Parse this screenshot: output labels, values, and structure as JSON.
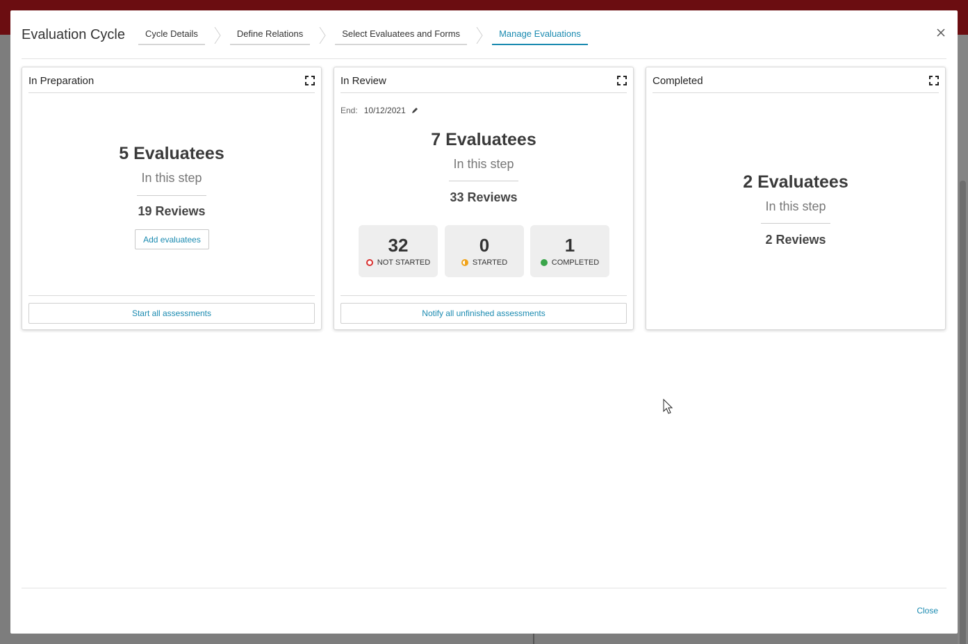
{
  "modal": {
    "title": "Evaluation Cycle",
    "steps": [
      {
        "label": "Cycle Details",
        "active": false
      },
      {
        "label": "Define Relations",
        "active": false
      },
      {
        "label": "Select Evaluatees and Forms",
        "active": false
      },
      {
        "label": "Manage Evaluations",
        "active": true
      }
    ],
    "close_icon": "close-icon",
    "footer_close_label": "Close"
  },
  "cards": {
    "preparation": {
      "title": "In Preparation",
      "evaluatees": "5 Evaluatees",
      "sub": "In this step",
      "reviews": "19 Reviews",
      "add_label": "Add evaluatees",
      "action_label": "Start all assessments"
    },
    "review": {
      "title": "In Review",
      "end_label": "End:",
      "end_value": "10/12/2021",
      "evaluatees": "7 Evaluatees",
      "sub": "In this step",
      "reviews": "33 Reviews",
      "stats": [
        {
          "value": "32",
          "label": "NOT STARTED",
          "color": "#d9302f"
        },
        {
          "value": "0",
          "label": "STARTED",
          "color": "#f0a31b"
        },
        {
          "value": "1",
          "label": "COMPLETED",
          "color": "#3aa54a"
        }
      ],
      "action_label": "Notify all unfinished assessments"
    },
    "completed": {
      "title": "Completed",
      "evaluatees": "2 Evaluatees",
      "sub": "In this step",
      "reviews": "2 Reviews"
    }
  },
  "colors": {
    "accent": "#1a8ab0",
    "topbar": "#6b0d11"
  }
}
